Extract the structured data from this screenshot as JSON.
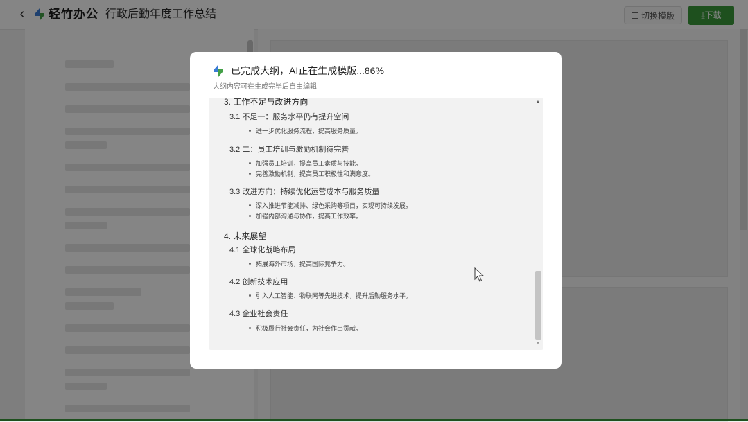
{
  "topbar": {
    "brand": "轻竹办公",
    "doc_title": "行政后勤年度工作总结",
    "switch_template": "切换模版",
    "download": "下载",
    "switch_icon": "template-icon",
    "download_icon": "download-icon"
  },
  "colors": {
    "accent_green": "#3a9a3a",
    "logo_blue": "#3a7bd5",
    "logo_green": "#43a047"
  },
  "modal": {
    "title": "已完成大纲，AI正在生成模版...86%",
    "progress_percent": 86,
    "subtitle": "大纲内容可在生成完毕后自由编辑",
    "outline": [
      {
        "heading": "3. 工作不足与改进方向",
        "items": [
          {
            "title": "3.1 不足一：服务水平仍有提升空间",
            "bullets": [
              "进一步优化服务流程，提高服务质量。"
            ]
          },
          {
            "title": "3.2 二：员工培训与激励机制待完善",
            "bullets": [
              "加强员工培训，提高员工素质与技能。",
              "完善激励机制，提高员工积极性和满意度。"
            ]
          },
          {
            "title": "3.3 改进方向：持续优化运营成本与服务质量",
            "bullets": [
              "深入推进节能减排、绿色采购等项目，实现可持续发展。",
              "加强内部沟通与协作，提高工作效率。"
            ]
          }
        ]
      },
      {
        "heading": "4. 未来展望",
        "items": [
          {
            "title": "4.1 全球化战略布局",
            "bullets": [
              "拓展海外市场，提高国际竞争力。"
            ]
          },
          {
            "title": "4.2 创新技术应用",
            "bullets": [
              "引入人工智能、物联网等先进技术，提升后勤服务水平。"
            ]
          },
          {
            "title": "4.3 企业社会责任",
            "bullets": [
              "积极履行社会责任，为社会作出贡献。"
            ]
          }
        ]
      }
    ]
  }
}
